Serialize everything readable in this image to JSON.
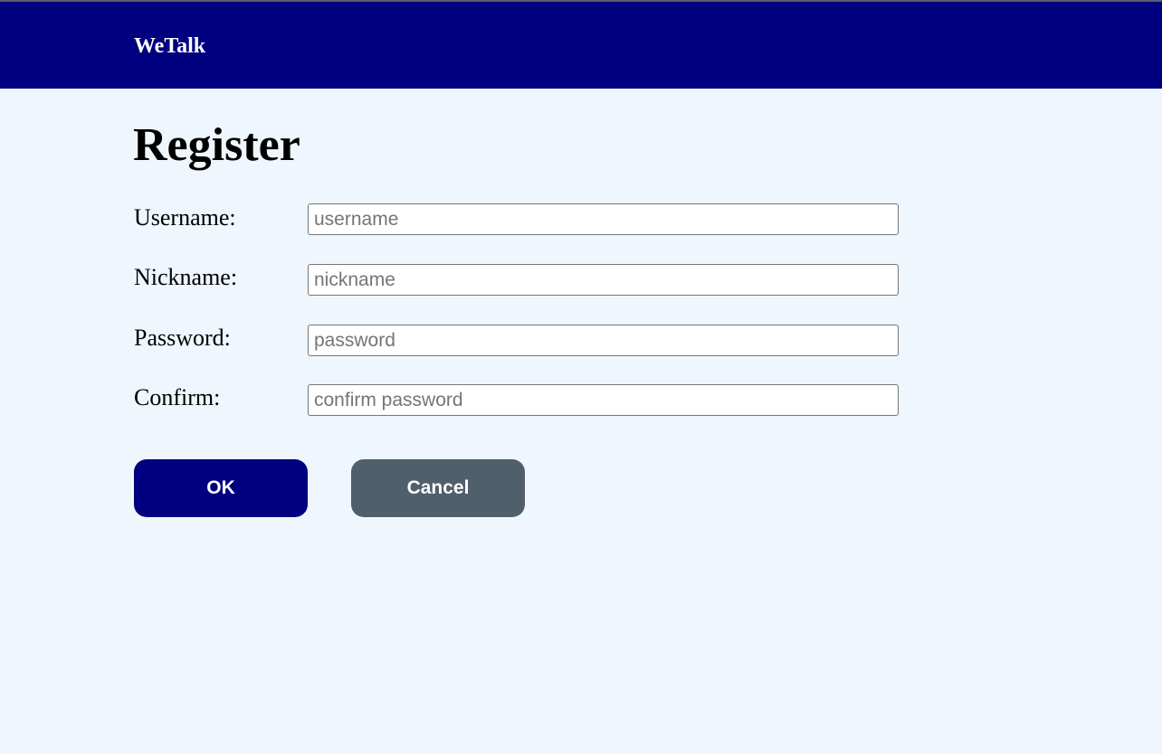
{
  "header": {
    "brand": "WeTalk",
    "background_color": "#000080"
  },
  "page": {
    "title": "Register",
    "background_color": "#eff6fd"
  },
  "form": {
    "username": {
      "label": "Username:",
      "placeholder": "username",
      "value": ""
    },
    "nickname": {
      "label": "Nickname:",
      "placeholder": "nickname",
      "value": ""
    },
    "password": {
      "label": "Password:",
      "placeholder": "password",
      "value": ""
    },
    "confirm": {
      "label": "Confirm:",
      "placeholder": "confirm password",
      "value": ""
    }
  },
  "buttons": {
    "ok": {
      "label": "OK",
      "color": "#000080"
    },
    "cancel": {
      "label": "Cancel",
      "color": "#505f6c"
    }
  }
}
